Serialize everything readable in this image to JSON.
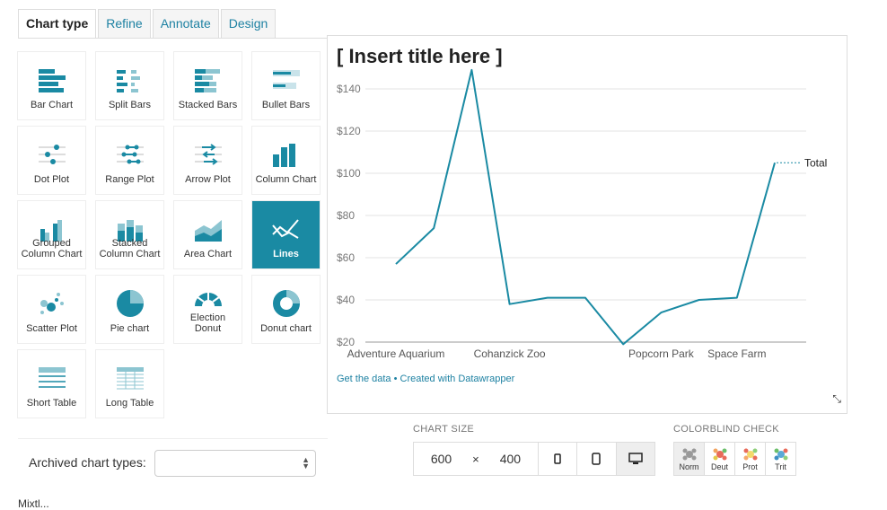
{
  "tabs": [
    "Chart type",
    "Refine",
    "Annotate",
    "Design"
  ],
  "chart_types": [
    {
      "label": "Bar Chart",
      "icon": "bar-chart-icon"
    },
    {
      "label": "Split Bars",
      "icon": "split-bars-icon"
    },
    {
      "label": "Stacked Bars",
      "icon": "stacked-bars-icon"
    },
    {
      "label": "Bullet Bars",
      "icon": "bullet-bars-icon"
    },
    {
      "label": "Dot Plot",
      "icon": "dot-plot-icon"
    },
    {
      "label": "Range Plot",
      "icon": "range-plot-icon"
    },
    {
      "label": "Arrow Plot",
      "icon": "arrow-plot-icon"
    },
    {
      "label": "Column Chart",
      "icon": "column-chart-icon"
    },
    {
      "label": "Grouped Column Chart",
      "icon": "grouped-column-icon"
    },
    {
      "label": "Stacked Column Chart",
      "icon": "stacked-column-icon"
    },
    {
      "label": "Area Chart",
      "icon": "area-chart-icon"
    },
    {
      "label": "Lines",
      "icon": "lines-icon",
      "selected": true
    },
    {
      "label": "Scatter Plot",
      "icon": "scatter-plot-icon"
    },
    {
      "label": "Pie chart",
      "icon": "pie-chart-icon"
    },
    {
      "label": "Election Donut",
      "icon": "election-donut-icon"
    },
    {
      "label": "Donut chart",
      "icon": "donut-chart-icon"
    },
    {
      "label": "Short Table",
      "icon": "short-table-icon"
    },
    {
      "label": "Long Table",
      "icon": "long-table-icon"
    }
  ],
  "archived": {
    "label": "Archived chart types:",
    "value": ""
  },
  "bottom_text": "Mixtl...",
  "preview": {
    "title": "[ Insert title here ]",
    "credits": "Get the data • Created with Datawrapper"
  },
  "chart_data": {
    "type": "line",
    "title": "[ Insert title here ]",
    "x": [
      "Adventure Aquarium",
      "",
      "",
      "Cohanzick Zoo",
      "",
      "",
      "",
      "Popcorn Park",
      "",
      "Space Farm",
      ""
    ],
    "x_tick_labels": [
      "Adventure Aquarium",
      "Cohanzick Zoo",
      "Popcorn Park",
      "Space Farm"
    ],
    "series": [
      {
        "name": "Total",
        "values": [
          57,
          74,
          149,
          38,
          41,
          41,
          19,
          34,
          40,
          41,
          105
        ]
      }
    ],
    "yticks": [
      "$20",
      "$40",
      "$60",
      "$80",
      "$100",
      "$120",
      "$140"
    ],
    "ylim": [
      20,
      150
    ],
    "grid": true,
    "color": "#1a8aa3"
  },
  "chart_size": {
    "label": "CHART SIZE",
    "width": "600",
    "height": "400",
    "times": "×"
  },
  "colorblind": {
    "label": "COLORBLIND CHECK",
    "modes": [
      "Norm",
      "Deut",
      "Prot",
      "Trit"
    ]
  },
  "colors": {
    "accent": "#1a8aa3",
    "link": "#1d81a2"
  }
}
